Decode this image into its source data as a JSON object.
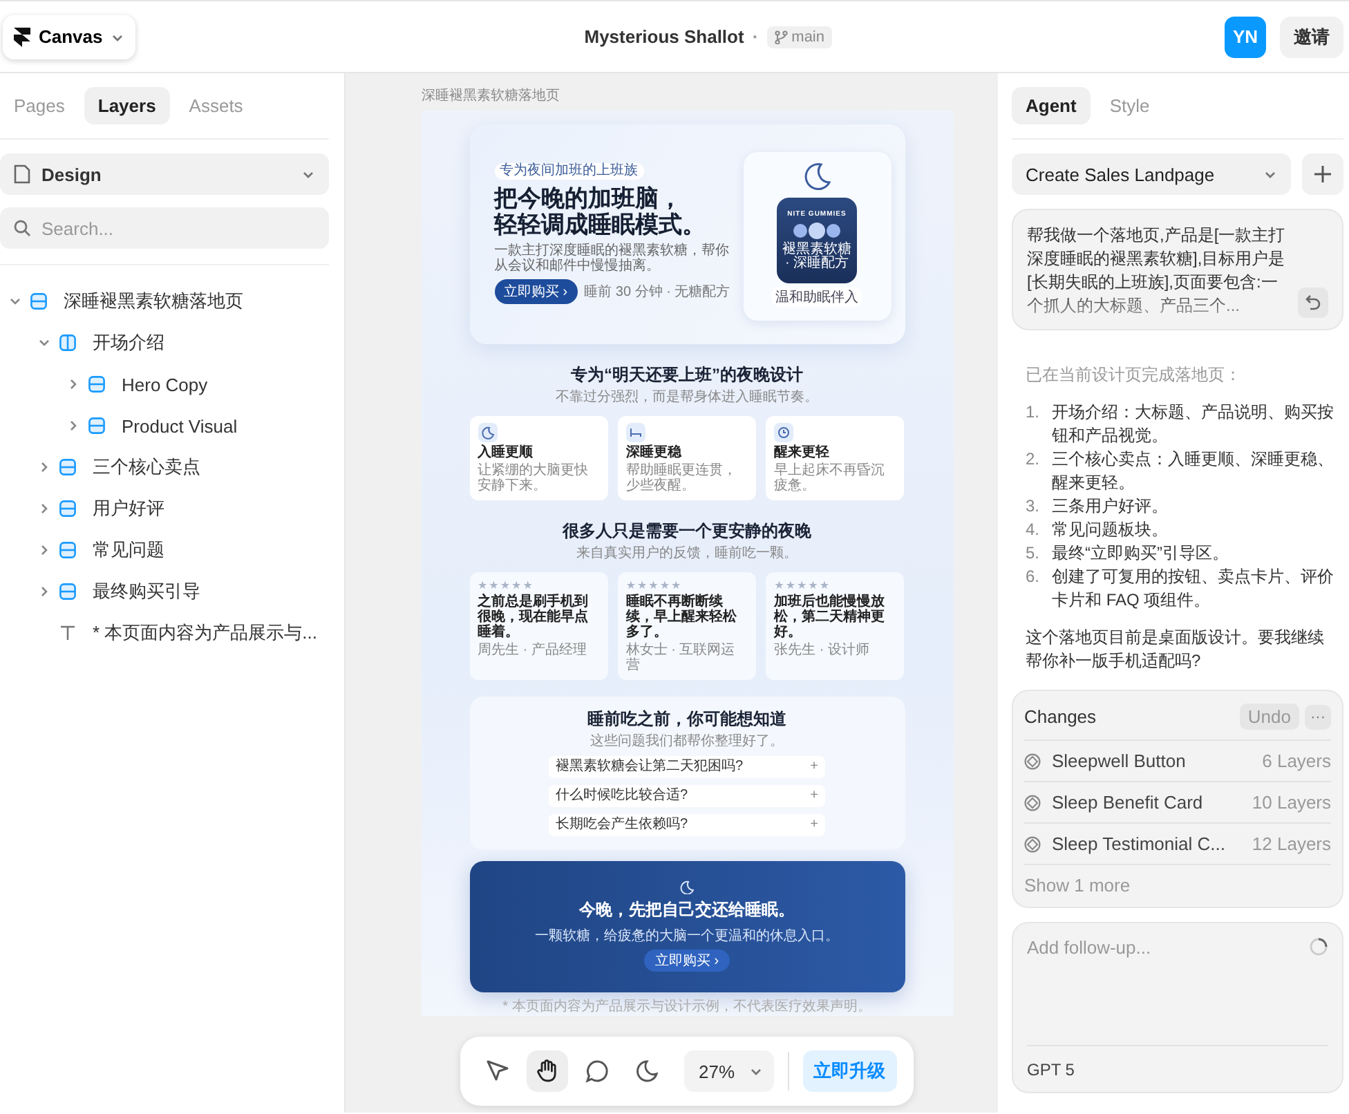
{
  "toolbar": {
    "project_menu": "Canvas",
    "file_title": "Mysterious Shallot",
    "separator": "·",
    "branch": "main",
    "avatar": "YN",
    "invite": "邀请"
  },
  "left_panel": {
    "tabs": [
      {
        "label": "Pages",
        "selected": false
      },
      {
        "label": "Layers",
        "selected": true
      },
      {
        "label": "Assets",
        "selected": false
      }
    ],
    "page_select": "Design",
    "search": {
      "placeholder": "Search..."
    },
    "layers": [
      {
        "name": "深睡褪黑素软糖落地页",
        "kind": "frame",
        "expanded": true,
        "children": [
          {
            "name": "开场介绍",
            "kind": "stack",
            "expanded": true,
            "children": [
              {
                "name": "Hero Copy",
                "kind": "frame",
                "expanded": false
              },
              {
                "name": "Product Visual",
                "kind": "frame",
                "expanded": false
              }
            ]
          },
          {
            "name": "三个核心卖点",
            "kind": "frame",
            "expanded": false
          },
          {
            "name": "用户好评",
            "kind": "frame",
            "expanded": false
          },
          {
            "name": "常见问题",
            "kind": "frame",
            "expanded": false
          },
          {
            "name": "最终购买引导",
            "kind": "frame",
            "expanded": false
          },
          {
            "name": "* 本页面内容为产品展示与...",
            "kind": "text"
          }
        ]
      }
    ]
  },
  "canvas": {
    "frame_label": "深睡褪黑素软糖落地页",
    "hero": {
      "badge": "专为夜间加班的上班族",
      "headline": [
        "把今晚的加班脑，",
        "轻轻调成睡眠模式。"
      ],
      "body": "一款主打深度睡眠的褪黑素软糖，帮你从会议和邮件中慢慢抽离。",
      "button": "立即购买 ›",
      "meta": "睡前 30 分钟 · 无糖配方",
      "product_brand": "NITE GUMMIES",
      "product_label": "褪黑素软糖 · 深睡配方",
      "product_tag": "温和助眠伴入"
    },
    "benefits": {
      "title": "专为“明天还要上班”的夜晚设计",
      "subtitle": "不靠过分强烈，而是帮身体进入睡眠节奏。",
      "cards": [
        {
          "kind": "moon",
          "title": "入睡更顺",
          "text": "让紧绷的大脑更快安静下来。"
        },
        {
          "kind": "bed",
          "title": "深睡更稳",
          "text": "帮助睡眠更连贯，少些夜醒。"
        },
        {
          "kind": "clock",
          "title": "醒来更轻",
          "text": "早上起床不再昏沉疲惫。"
        }
      ]
    },
    "reviews": {
      "title": "很多人只是需要一个更安静的夜晚",
      "subtitle": "来自真实用户的反馈，睡前吃一颗。",
      "items": [
        {
          "stars": 5,
          "quote": "之前总是刷手机到很晚，现在能早点睡着。",
          "author": "周先生 · 产品经理"
        },
        {
          "stars": 5,
          "quote": "睡眠不再断断续续，早上醒来轻松多了。",
          "author": "林女士 · 互联网运营"
        },
        {
          "stars": 5,
          "quote": "加班后也能慢慢放松，第二天精神更好。",
          "author": "张先生 · 设计师"
        }
      ]
    },
    "faq": {
      "title": "睡前吃之前，你可能想知道",
      "subtitle": "这些问题我们都帮你整理好了。",
      "items": [
        {
          "question": "褪黑素软糖会让第二天犯困吗?",
          "toggle": "+"
        },
        {
          "question": "什么时候吃比较合适?",
          "toggle": "+"
        },
        {
          "question": "长期吃会产生依赖吗?",
          "toggle": "+"
        }
      ]
    },
    "cta": {
      "title": "今晚，先把自己交还给睡眠。",
      "subtitle": "一颗软糖，给疲惫的大脑一个更温和的休息入口。",
      "button": "立即购买 ›"
    },
    "footnote": "* 本页面内容为产品展示与设计示例，不代表医疗效果声明。"
  },
  "bottom_toolbar": {
    "tools": [
      {
        "kind": "pointer",
        "selected": false
      },
      {
        "kind": "hand",
        "selected": true
      },
      {
        "kind": "comment",
        "selected": false
      },
      {
        "kind": "moon",
        "selected": false
      }
    ],
    "zoom": "27%",
    "upgrade": "立即升级"
  },
  "right_panel": {
    "tabs": [
      {
        "label": "Agent",
        "selected": true
      },
      {
        "label": "Style",
        "selected": false
      }
    ],
    "thread_select": "Create Sales Landpage",
    "prompt": "帮我做一个落地页,产品是[一款主打深度睡眠的褪黑素软糖],目标用户是[长期失眠的上班族],页面要包含:一个抓人的大标题、产品三个...",
    "reply_intro": "已在当前设计页完成落地页：",
    "reply_steps": [
      {
        "number": "1.",
        "text": "开场介绍：大标题、产品说明、购买按钮和产品视觉。"
      },
      {
        "number": "2.",
        "text": "三个核心卖点：入睡更顺、深睡更稳、醒来更轻。"
      },
      {
        "number": "3.",
        "text": "三条用户好评。"
      },
      {
        "number": "4.",
        "text": "常见问题板块。"
      },
      {
        "number": "5.",
        "text": "最终“立即购买”引导区。"
      },
      {
        "number": "6.",
        "text": "创建了可复用的按钮、卖点卡片、评价卡片和 FAQ 项组件。"
      }
    ],
    "reply_question": "这个落地页目前是桌面版设计。要我继续帮你补一版手机适配吗?",
    "changes": {
      "title": "Changes",
      "undo": "Undo",
      "more": "···",
      "items": [
        {
          "name": "Sleepwell Button",
          "count": "6 Layers"
        },
        {
          "name": "Sleep Benefit Card",
          "count": "10 Layers"
        },
        {
          "name": "Sleep Testimonial C...",
          "count": "12 Layers"
        }
      ],
      "show_more": "Show 1 more"
    },
    "follow_up": {
      "placeholder": "Add follow-up...",
      "model": "GPT 5"
    }
  }
}
